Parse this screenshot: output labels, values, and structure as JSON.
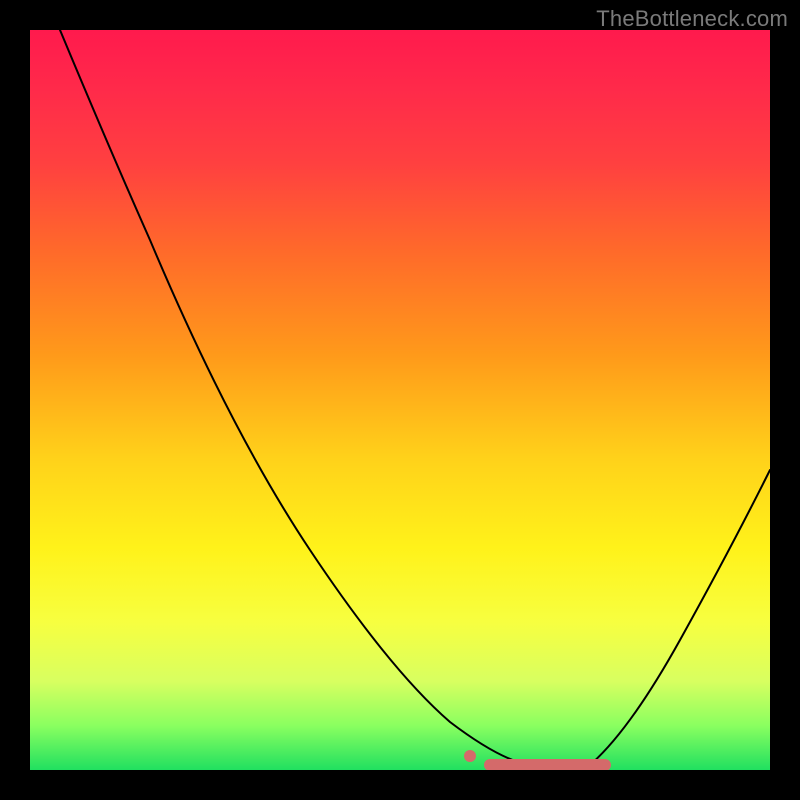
{
  "watermark": "TheBottleneck.com",
  "colors": {
    "curve": "#000000",
    "highlight": "#d46a6a",
    "gradient_top": "#ff1a4d",
    "gradient_bottom": "#20e060",
    "page_bg": "#000000"
  },
  "chart_data": {
    "type": "line",
    "title": "",
    "xlabel": "",
    "ylabel": "",
    "xlim": [
      0,
      100
    ],
    "ylim": [
      0,
      100
    ],
    "series": [
      {
        "name": "bottleneck-curve",
        "x": [
          4,
          11,
          16,
          27,
          38,
          49,
          57,
          64,
          68,
          76,
          78,
          81,
          88,
          95,
          100
        ],
        "y": [
          100,
          84,
          72,
          46,
          30,
          14,
          6.5,
          1,
          0.7,
          0.7,
          0.7,
          5,
          18,
          30,
          41
        ]
      }
    ],
    "annotations": [
      {
        "name": "optimal-range",
        "x_start": 62,
        "x_end": 78,
        "y": 0.7
      },
      {
        "name": "marker-dot",
        "x": 59,
        "y": 2
      }
    ],
    "legend": false,
    "grid": false
  }
}
